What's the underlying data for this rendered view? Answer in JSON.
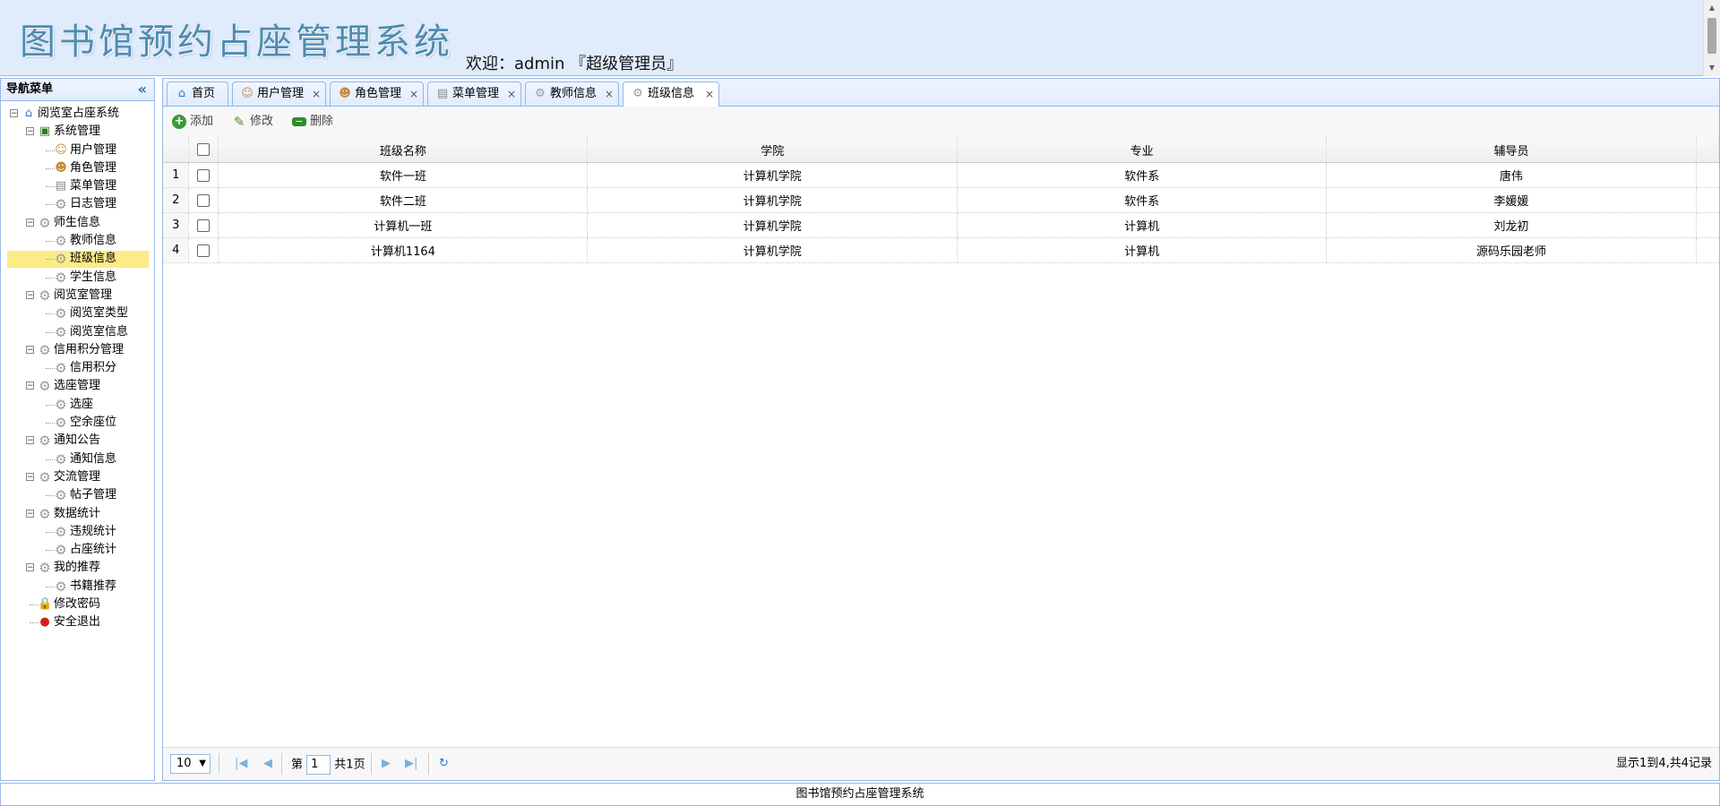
{
  "header": {
    "system_title": "图书馆预约占座管理系统",
    "welcome": "欢迎：admin 『超级管理员』"
  },
  "nav": {
    "title": "导航菜单",
    "collapse_icon": "double-chevron-left-icon",
    "tree": [
      {
        "label": "阅览室占座系统",
        "level": 0,
        "icon": "home-icon",
        "toggle": "−"
      },
      {
        "label": "系统管理",
        "level": 1,
        "icon": "folder-icon",
        "toggle": "−"
      },
      {
        "label": "用户管理",
        "level": 2,
        "icon": "user-icon"
      },
      {
        "label": "角色管理",
        "level": 2,
        "icon": "role-icon"
      },
      {
        "label": "菜单管理",
        "level": 2,
        "icon": "menu-icon"
      },
      {
        "label": "日志管理",
        "level": 2,
        "icon": "gear-icon"
      },
      {
        "label": "师生信息",
        "level": 1,
        "icon": "gear-icon",
        "toggle": "−"
      },
      {
        "label": "教师信息",
        "level": 2,
        "icon": "gear-icon"
      },
      {
        "label": "班级信息",
        "level": 2,
        "icon": "gear-icon",
        "selected": true
      },
      {
        "label": "学生信息",
        "level": 2,
        "icon": "gear-icon"
      },
      {
        "label": "阅览室管理",
        "level": 1,
        "icon": "gear-icon",
        "toggle": "−"
      },
      {
        "label": "阅览室类型",
        "level": 2,
        "icon": "gear-icon"
      },
      {
        "label": "阅览室信息",
        "level": 2,
        "icon": "gear-icon"
      },
      {
        "label": "信用积分管理",
        "level": 1,
        "icon": "gear-icon",
        "toggle": "−"
      },
      {
        "label": "信用积分",
        "level": 2,
        "icon": "gear-icon"
      },
      {
        "label": "选座管理",
        "level": 1,
        "icon": "gear-icon",
        "toggle": "−"
      },
      {
        "label": "选座",
        "level": 2,
        "icon": "gear-icon"
      },
      {
        "label": "空余座位",
        "level": 2,
        "icon": "gear-icon"
      },
      {
        "label": "通知公告",
        "level": 1,
        "icon": "gear-icon",
        "toggle": "−"
      },
      {
        "label": "通知信息",
        "level": 2,
        "icon": "gear-icon"
      },
      {
        "label": "交流管理",
        "level": 1,
        "icon": "gear-icon",
        "toggle": "−"
      },
      {
        "label": "帖子管理",
        "level": 2,
        "icon": "gear-icon"
      },
      {
        "label": "数据统计",
        "level": 1,
        "icon": "gear-icon",
        "toggle": "−"
      },
      {
        "label": "违规统计",
        "level": 2,
        "icon": "gear-icon"
      },
      {
        "label": "占座统计",
        "level": 2,
        "icon": "gear-icon"
      },
      {
        "label": "我的推荐",
        "level": 1,
        "icon": "gear-icon",
        "toggle": "−"
      },
      {
        "label": "书籍推荐",
        "level": 2,
        "icon": "gear-icon"
      },
      {
        "label": "修改密码",
        "level": 1,
        "icon": "lock-icon"
      },
      {
        "label": "安全退出",
        "level": 1,
        "icon": "exit-icon"
      }
    ]
  },
  "tabs": [
    {
      "label": "首页",
      "icon": "home-icon",
      "closable": false
    },
    {
      "label": "用户管理",
      "icon": "user-icon",
      "closable": true
    },
    {
      "label": "角色管理",
      "icon": "role-icon",
      "closable": true
    },
    {
      "label": "菜单管理",
      "icon": "menu-icon",
      "closable": true
    },
    {
      "label": "教师信息",
      "icon": "gear-icon",
      "closable": true
    },
    {
      "label": "班级信息",
      "icon": "gear-icon",
      "closable": true,
      "active": true
    }
  ],
  "toolbar": {
    "add_label": "添加",
    "edit_label": "修改",
    "delete_label": "删除"
  },
  "grid": {
    "columns": [
      "班级名称",
      "学院",
      "专业",
      "辅导员"
    ],
    "rows": [
      {
        "num": "1",
        "cells": [
          "软件一班",
          "计算机学院",
          "软件系",
          "唐伟"
        ]
      },
      {
        "num": "2",
        "cells": [
          "软件二班",
          "计算机学院",
          "软件系",
          "李媛媛"
        ]
      },
      {
        "num": "3",
        "cells": [
          "计算机一班",
          "计算机学院",
          "计算机",
          "刘龙初"
        ]
      },
      {
        "num": "4",
        "cells": [
          "计算机1164",
          "计算机学院",
          "计算机",
          "源码乐园老师"
        ]
      }
    ]
  },
  "pager": {
    "page_size": "10",
    "page_prefix": "第",
    "page_value": "1",
    "page_total": "共1页",
    "info": "显示1到4,共4记录"
  },
  "footer": {
    "text": "图书馆预约占座管理系统"
  },
  "colors": {
    "border": "#95b8e7",
    "header_bg": "#e0ecfb",
    "selected_bg": "#fbec88",
    "title_color": "#4f8bb0"
  }
}
